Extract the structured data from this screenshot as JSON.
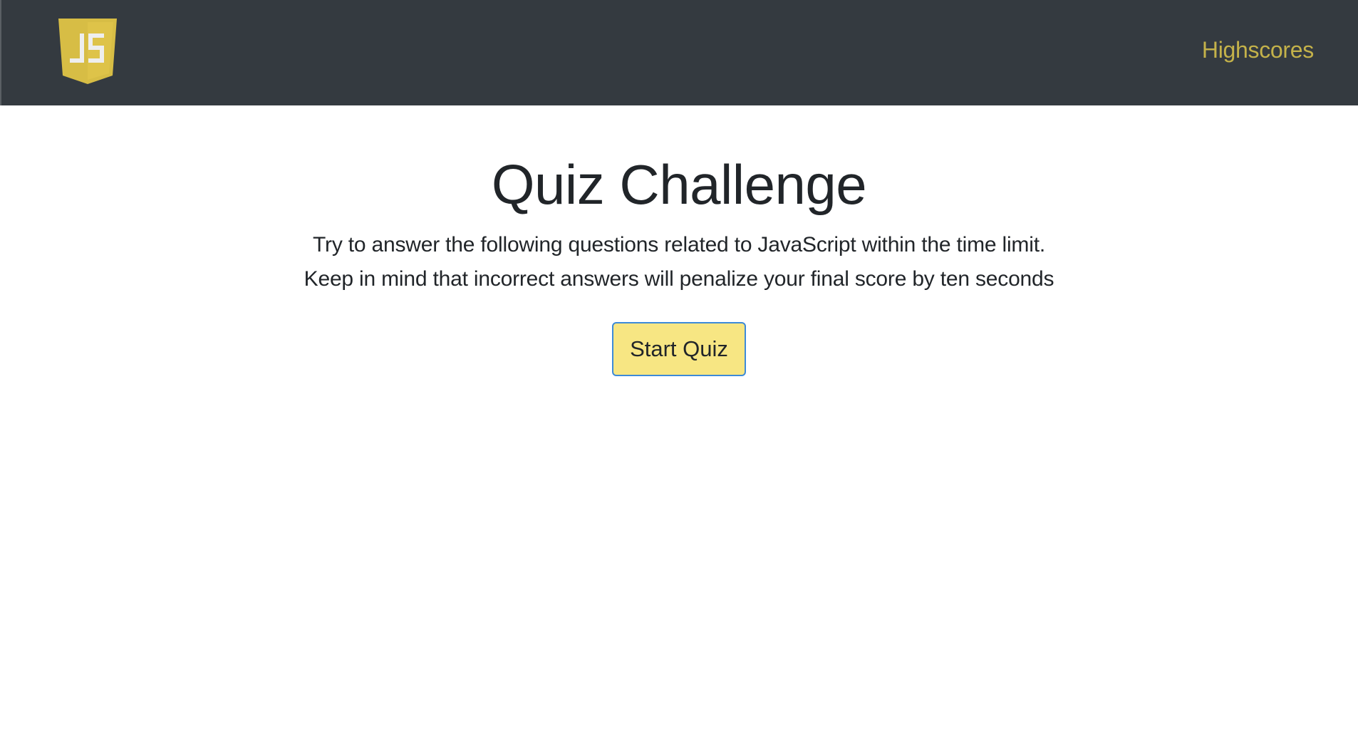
{
  "navbar": {
    "logo_text": "JS",
    "highscores_label": "Highscores"
  },
  "main": {
    "title": "Quiz Challenge",
    "description_line1": "Try to answer the following questions related to JavaScript within the time limit.",
    "description_line2": "Keep in mind that incorrect answers will penalize your final score by ten seconds",
    "start_button_label": "Start Quiz"
  },
  "colors": {
    "navbar_bg": "#343a40",
    "link": "#c4b24a",
    "logo": "#d7bd45",
    "button_bg": "#f7e683",
    "button_border": "#3d8ad8"
  },
  "icons": {
    "logo": "javascript-shield-logo"
  }
}
